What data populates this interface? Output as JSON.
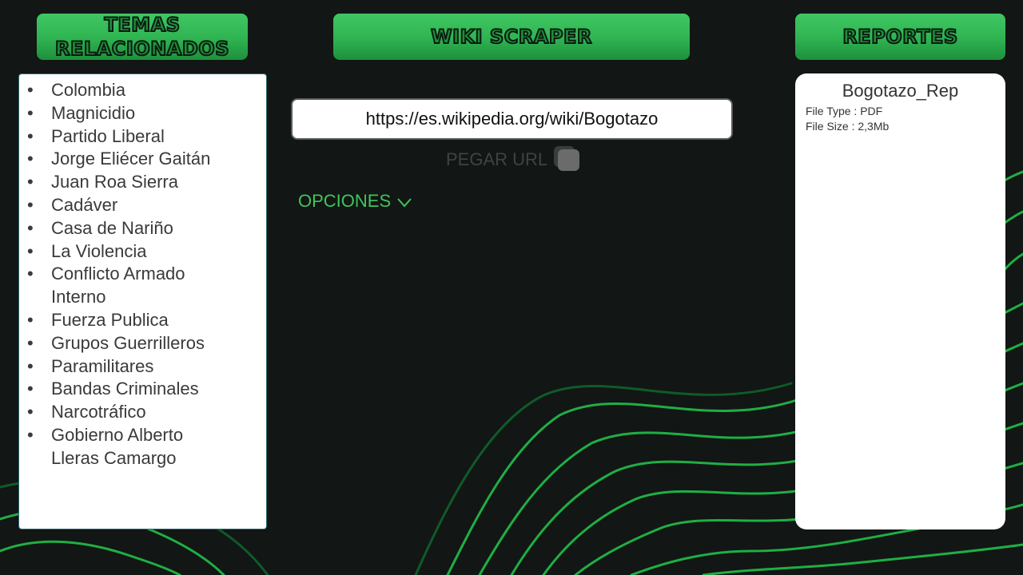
{
  "header": {
    "temas_label": "TEMAS RELACIONADOS",
    "wiki_label": "WIKI SCRAPER",
    "reportes_label": "REPORTES"
  },
  "topics": [
    "Colombia",
    "Magnicidio",
    "Partido Liberal",
    "Jorge Eliécer Gaitán",
    "Juan Roa Sierra",
    "Cadáver",
    "Casa de Nariño",
    "La Violencia",
    "Conflicto Armado Interno",
    "Fuerza Publica",
    "Grupos Guerrilleros",
    "Paramilitares",
    "Bandas Criminales",
    "Narcotráfico",
    "Gobierno Alberto Lleras Camargo"
  ],
  "scraper": {
    "url_value": "https://es.wikipedia.org/wiki/Bogotazo",
    "paste_label": "PEGAR URL",
    "options_label": "OPCIONES"
  },
  "report": {
    "title": "Bogotazo_Rep",
    "file_type": "File Type : PDF",
    "file_size": "File Size : 2,3Mb"
  },
  "colors": {
    "background": "#121614",
    "accent_green": "#2fb351",
    "options_text": "#3fc45f"
  },
  "icons": {
    "options": "chevron-down-icon"
  }
}
